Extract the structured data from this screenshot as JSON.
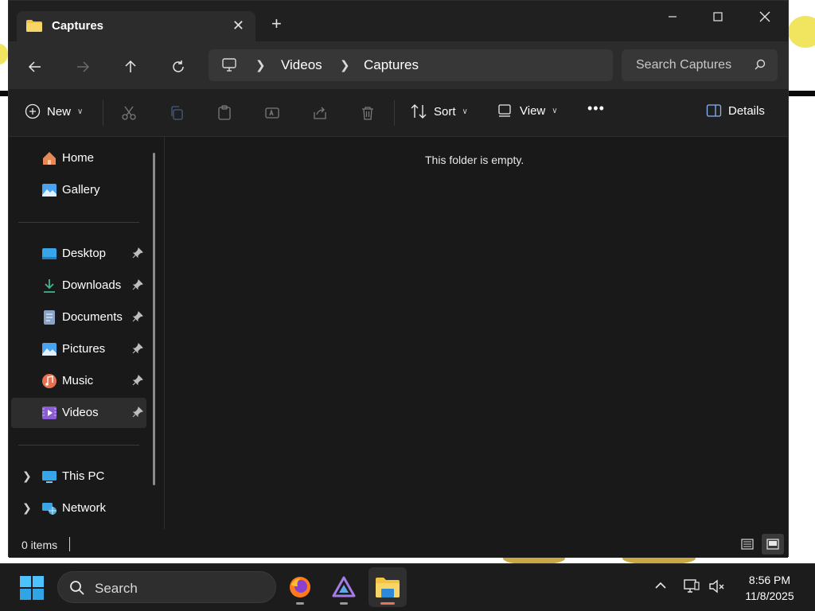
{
  "window": {
    "tab_title": "Captures",
    "new_tab_label": "+",
    "controls": {
      "minimize": "minimize-icon",
      "maximize": "maximize-icon",
      "close": "close-icon"
    }
  },
  "address_bar": {
    "breadcrumbs": [
      "Videos",
      "Captures"
    ],
    "root_icon": "this-pc-icon"
  },
  "search": {
    "placeholder": "Search Captures"
  },
  "toolbar": {
    "new_label": "New",
    "sort_label": "Sort",
    "view_label": "View",
    "more_label": "•••",
    "details_label": "Details"
  },
  "sidebar": {
    "quick": [
      {
        "label": "Home",
        "icon": "home-icon"
      },
      {
        "label": "Gallery",
        "icon": "gallery-icon"
      }
    ],
    "pinned": [
      {
        "label": "Desktop",
        "icon": "desktop-icon"
      },
      {
        "label": "Downloads",
        "icon": "downloads-icon"
      },
      {
        "label": "Documents",
        "icon": "documents-icon"
      },
      {
        "label": "Pictures",
        "icon": "pictures-icon"
      },
      {
        "label": "Music",
        "icon": "music-icon"
      },
      {
        "label": "Videos",
        "icon": "videos-icon",
        "selected": true
      }
    ],
    "locations": [
      {
        "label": "This PC",
        "icon": "this-pc-icon"
      },
      {
        "label": "Network",
        "icon": "network-icon"
      }
    ]
  },
  "content": {
    "empty_message": "This folder is empty."
  },
  "status": {
    "items": "0 items"
  },
  "taskbar": {
    "search_label": "Search",
    "apps": [
      "firefox-icon",
      "app-icon",
      "file-explorer-icon"
    ],
    "time": "8:56 PM",
    "date": "11/8/2025"
  },
  "colors": {
    "window_bg": "#191919",
    "toolbar_bg": "#202020",
    "address_bg": "#2c2c2c",
    "accent": "#e5745b"
  }
}
